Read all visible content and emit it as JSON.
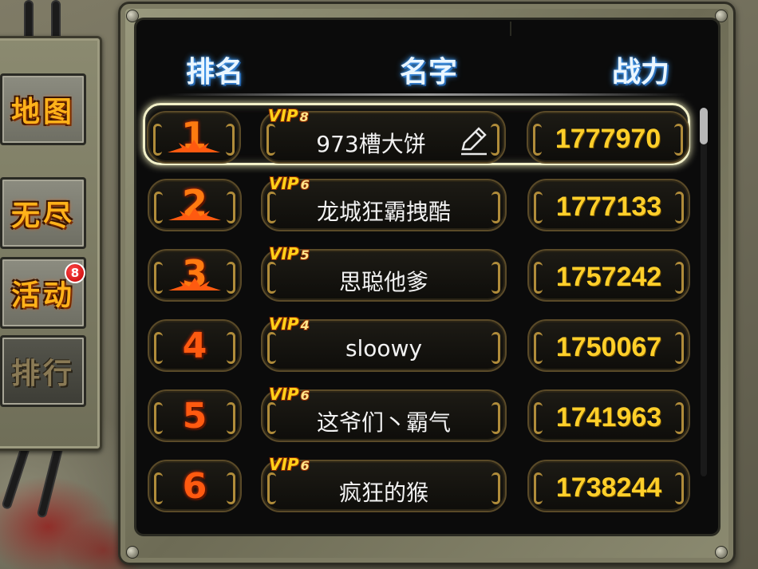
{
  "sidebar": {
    "items": [
      {
        "label": "地图",
        "selected": false
      },
      {
        "label": "无尽",
        "selected": false
      },
      {
        "label": "活动",
        "selected": false,
        "badge": "8"
      },
      {
        "label": "排行",
        "selected": true
      }
    ]
  },
  "leaderboard": {
    "headers": {
      "rank": "排名",
      "name": "名字",
      "power": "战力"
    },
    "rows": [
      {
        "rank": "1",
        "vip": "8",
        "name": "973槽大饼",
        "power": "1777970",
        "is_self": true
      },
      {
        "rank": "2",
        "vip": "6",
        "name": "龙城狂霸拽酷",
        "power": "1777133",
        "is_self": false
      },
      {
        "rank": "3",
        "vip": "5",
        "name": "思聪他爹",
        "power": "1757242",
        "is_self": false
      },
      {
        "rank": "4",
        "vip": "4",
        "name": "sloowy",
        "power": "1750067",
        "is_self": false
      },
      {
        "rank": "5",
        "vip": "6",
        "name": "这爷们丶霸气",
        "power": "1741963",
        "is_self": false
      },
      {
        "rank": "6",
        "vip": "6",
        "name": "疯狂的猴",
        "power": "1738244",
        "is_self": false
      }
    ],
    "vip_label": "VIP"
  },
  "icons": {
    "edit": "pencil-edit-icon"
  },
  "colors": {
    "power_text": "#ffcf2a",
    "rank_text": "#ff5a10",
    "header_text": "#eaf6ff",
    "self_highlight": "#f2f0c8"
  }
}
